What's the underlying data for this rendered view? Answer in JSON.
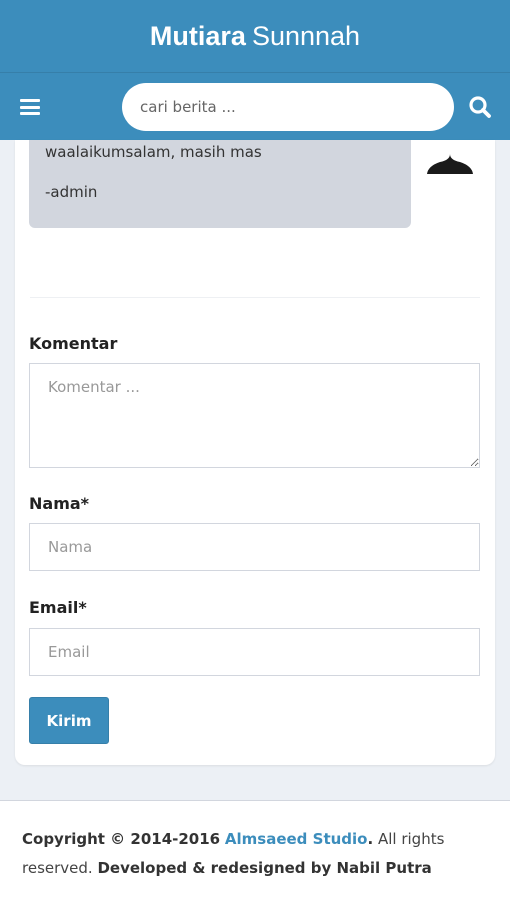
{
  "header": {
    "brand_bold": "Mutiara",
    "brand_light": "Sunnnah"
  },
  "navbar": {
    "menu_icon": "hamburger-icon",
    "search_placeholder": "cari berita ...",
    "search_icon": "search-icon"
  },
  "comment": {
    "line1": "waalaikumsalam, masih mas",
    "line2": "-admin",
    "avatar_icon": "user-avatar-icon"
  },
  "form": {
    "komentar_label": "Komentar",
    "komentar_placeholder": "Komentar ...",
    "nama_label": "Nama*",
    "nama_placeholder": "Nama",
    "email_label": "Email*",
    "email_placeholder": "Email",
    "submit_label": "Kirim"
  },
  "footer": {
    "copyright_prefix": "Copyright © 2014-2016",
    "studio_link": "Almsaeed Studio",
    "period": ".",
    "rights": "All rights reserved.",
    "developer": "Developed & redesigned by Nabil Putra"
  },
  "colors": {
    "primary": "#3c8dbc",
    "bubble": "#d2d6de",
    "background": "#ecf0f5"
  }
}
